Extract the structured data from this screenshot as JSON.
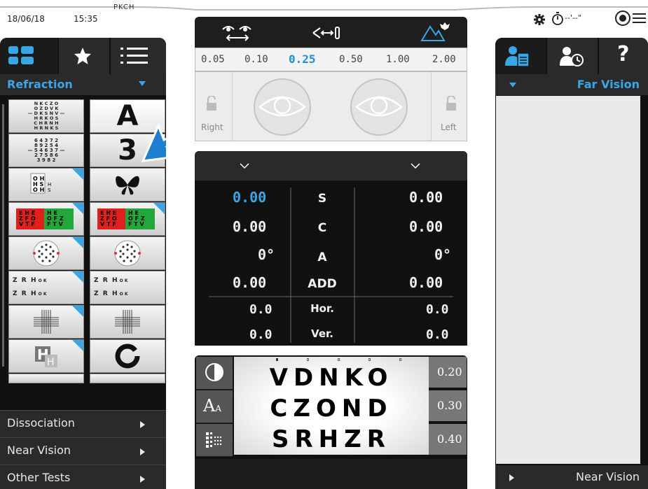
{
  "header": {
    "date": "18/06/18",
    "time": "15:35",
    "device": "PKCH",
    "timer_text": "--'--\"",
    "icons": [
      "gear-icon",
      "stopwatch-icon",
      "menu-icon"
    ]
  },
  "left_panel": {
    "tabs": [
      "grid-icon",
      "star-icon",
      "list-icon"
    ],
    "section_title": "Refraction",
    "charts": [
      {
        "left": "NKCZO\nOZDVK\nDKSNV\nHRKOS\nCHRNH\nHRNKS",
        "right": "A"
      },
      {
        "left": "64372\n89254\n54637\n27586\n3 9 8 2",
        "right": "3"
      },
      {
        "left": "OH HS",
        "right": "butterfly"
      },
      {
        "left": "E H E\nZ F O\nV T F\nO E D",
        "right": "E H E\nZ F O\nV T F\nO E D"
      },
      {
        "left": "dots",
        "right": "dots"
      },
      {
        "left": "Z R H O K\nZ R H O K",
        "right": "Z R H O K\nZ R H O K"
      },
      {
        "left": "cross",
        "right": "cross"
      },
      {
        "left": "H",
        "right": "O"
      }
    ],
    "bottom_items": [
      "Dissociation",
      "Near Vision",
      "Other Tests"
    ]
  },
  "center": {
    "steps": [
      "0.05",
      "0.10",
      "0.25",
      "0.50",
      "1.00",
      "2.00"
    ],
    "active_step": "0.25",
    "right_label": "Right",
    "left_label": "Left",
    "values": {
      "rows": [
        {
          "label": "S",
          "right": "0.00",
          "left": "0.00"
        },
        {
          "label": "C",
          "right": "0.00",
          "left": "0.00"
        },
        {
          "label": "A",
          "right": "0°",
          "left": "0°"
        },
        {
          "label": "ADD",
          "right": "0.00",
          "left": "0.00"
        },
        {
          "label": "Hor.",
          "right": "0.0",
          "left": "0.0"
        },
        {
          "label": "Ver.",
          "right": "0.0",
          "left": "0.0"
        }
      ]
    },
    "chart_rows": [
      "VDNKO",
      "CZOND",
      "SRHZR"
    ],
    "acuities": [
      "0.20",
      "0.30",
      "0.40"
    ]
  },
  "right_panel": {
    "tabs": [
      "patient-record-icon",
      "history-icon",
      "help-icon"
    ],
    "help_label": "?",
    "section_title": "Far Vision",
    "bottom_label": "Near Vision"
  },
  "colors": {
    "accent": "#3aa6e6",
    "panel": "#111111",
    "highlight_arrow": "#1e7fd0"
  }
}
